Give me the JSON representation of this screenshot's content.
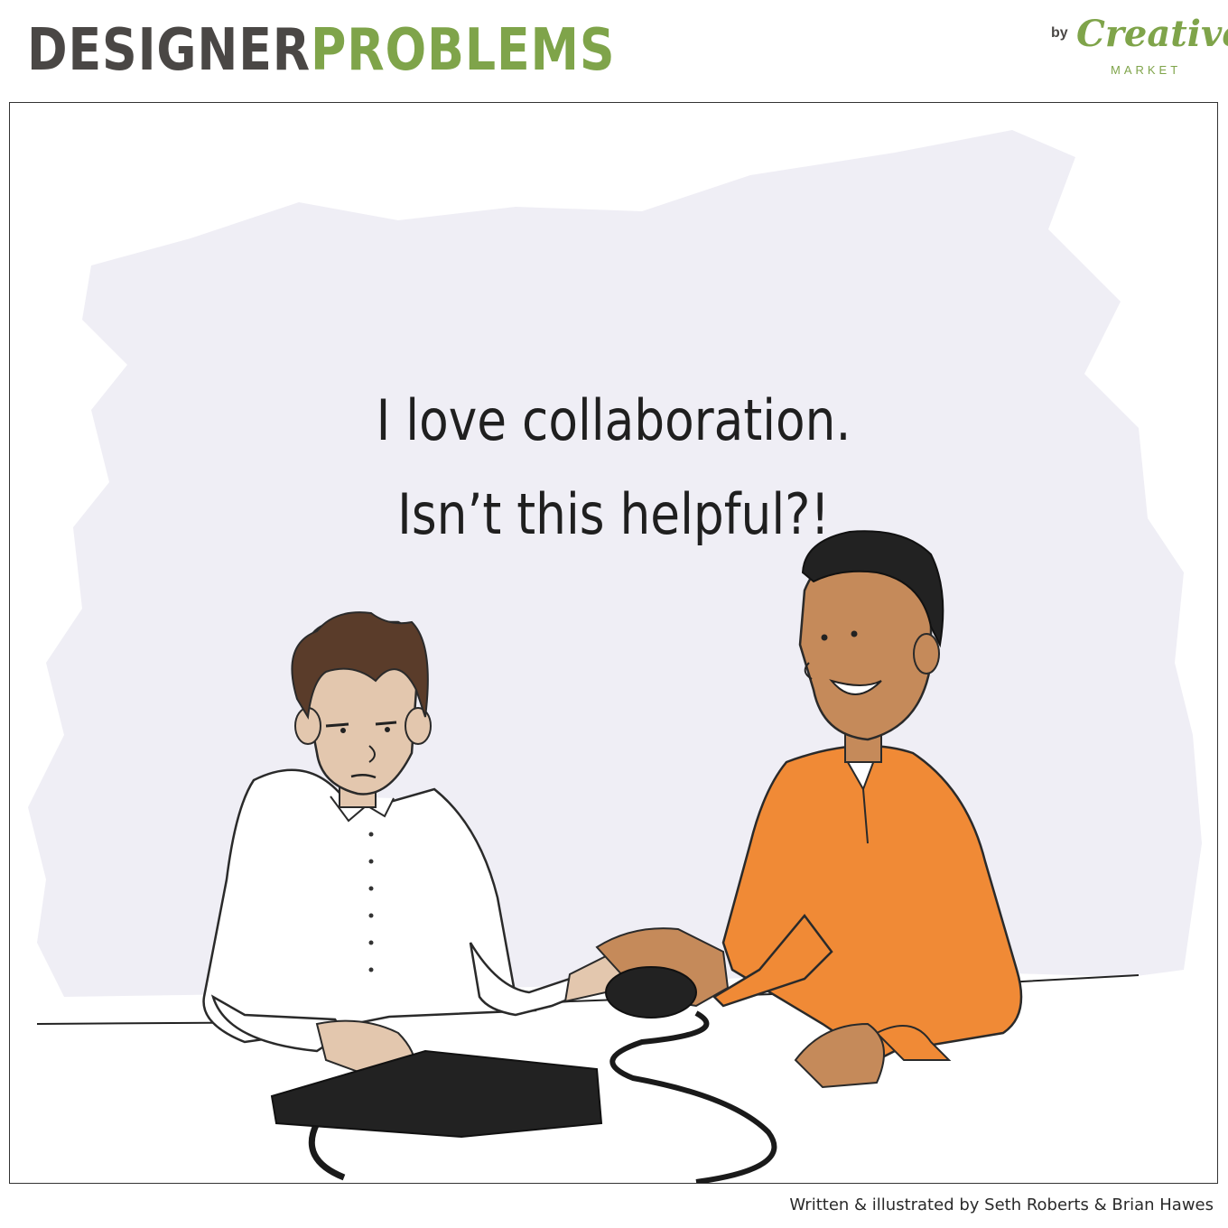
{
  "header": {
    "title_part1": "DESIGNER",
    "title_part2": "PROBLEMS"
  },
  "brand": {
    "by": "by",
    "name": "Creative",
    "sub": "MARKET"
  },
  "comic": {
    "caption_line1": "I love collaboration.",
    "caption_line2": "Isn’t this helpful?!"
  },
  "credit": "Written & illustrated by Seth Roberts & Brian Hawes",
  "colors": {
    "title_dark": "#4a4745",
    "title_green": "#7fa44a",
    "backdrop": "#efeef5",
    "orange_sweater": "#f08a36",
    "skin_light": "#e3c7ae",
    "skin_dark": "#c58a5a",
    "hair_brown": "#5a3c2a",
    "hair_black": "#222222"
  }
}
